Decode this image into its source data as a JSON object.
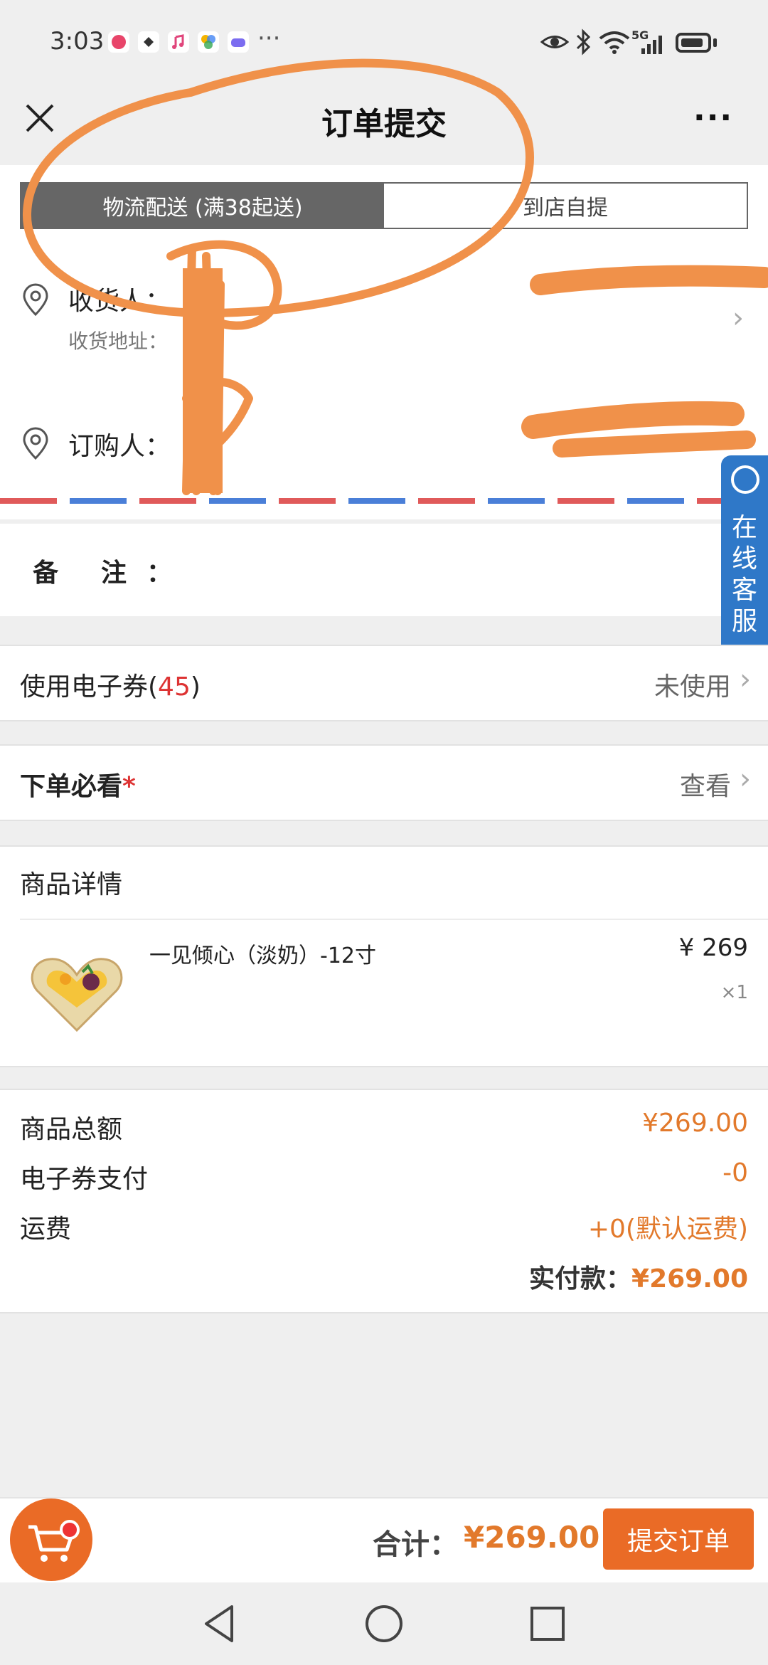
{
  "status_bar": {
    "time": "3:03",
    "dots": "···",
    "network": "5G"
  },
  "header": {
    "title": "订单提交",
    "more": "···"
  },
  "delivery_tabs": [
    {
      "label": "物流配送 (满38起送)",
      "active": true
    },
    {
      "label": "到店自提",
      "active": false
    }
  ],
  "address": {
    "consignee_label": "收货人：",
    "address_label": "收货地址：",
    "buyer_label": "订购人："
  },
  "remark": {
    "label": "备注",
    "colon": "："
  },
  "service_float": {
    "label": "在线客服"
  },
  "coupon_row": {
    "label_prefix": "使用电子券(",
    "count": "45",
    "label_suffix": ")",
    "value": "未使用"
  },
  "notice_row": {
    "label": "下单必看",
    "required_mark": "*",
    "value": "查看"
  },
  "goods": {
    "header": "商品详情",
    "items": [
      {
        "name": "一见倾心（淡奶）-12寸",
        "price": "¥ 269",
        "qty": "×1"
      }
    ]
  },
  "summary": {
    "rows": [
      {
        "label": "商品总额",
        "value": "¥269.00"
      },
      {
        "label": "电子券支付",
        "value": "-0"
      },
      {
        "label": "运费",
        "value": "+0(默认运费)"
      }
    ],
    "paid_label": "实付款：",
    "paid_value": "¥269.00"
  },
  "footer": {
    "total_label": "合计：",
    "total_value": "¥269.00",
    "submit_label": "提交订单"
  },
  "colors": {
    "accent": "#ea6b26",
    "price": "#e2792b",
    "service": "#2f78c8",
    "scribble": "#f0914a"
  }
}
